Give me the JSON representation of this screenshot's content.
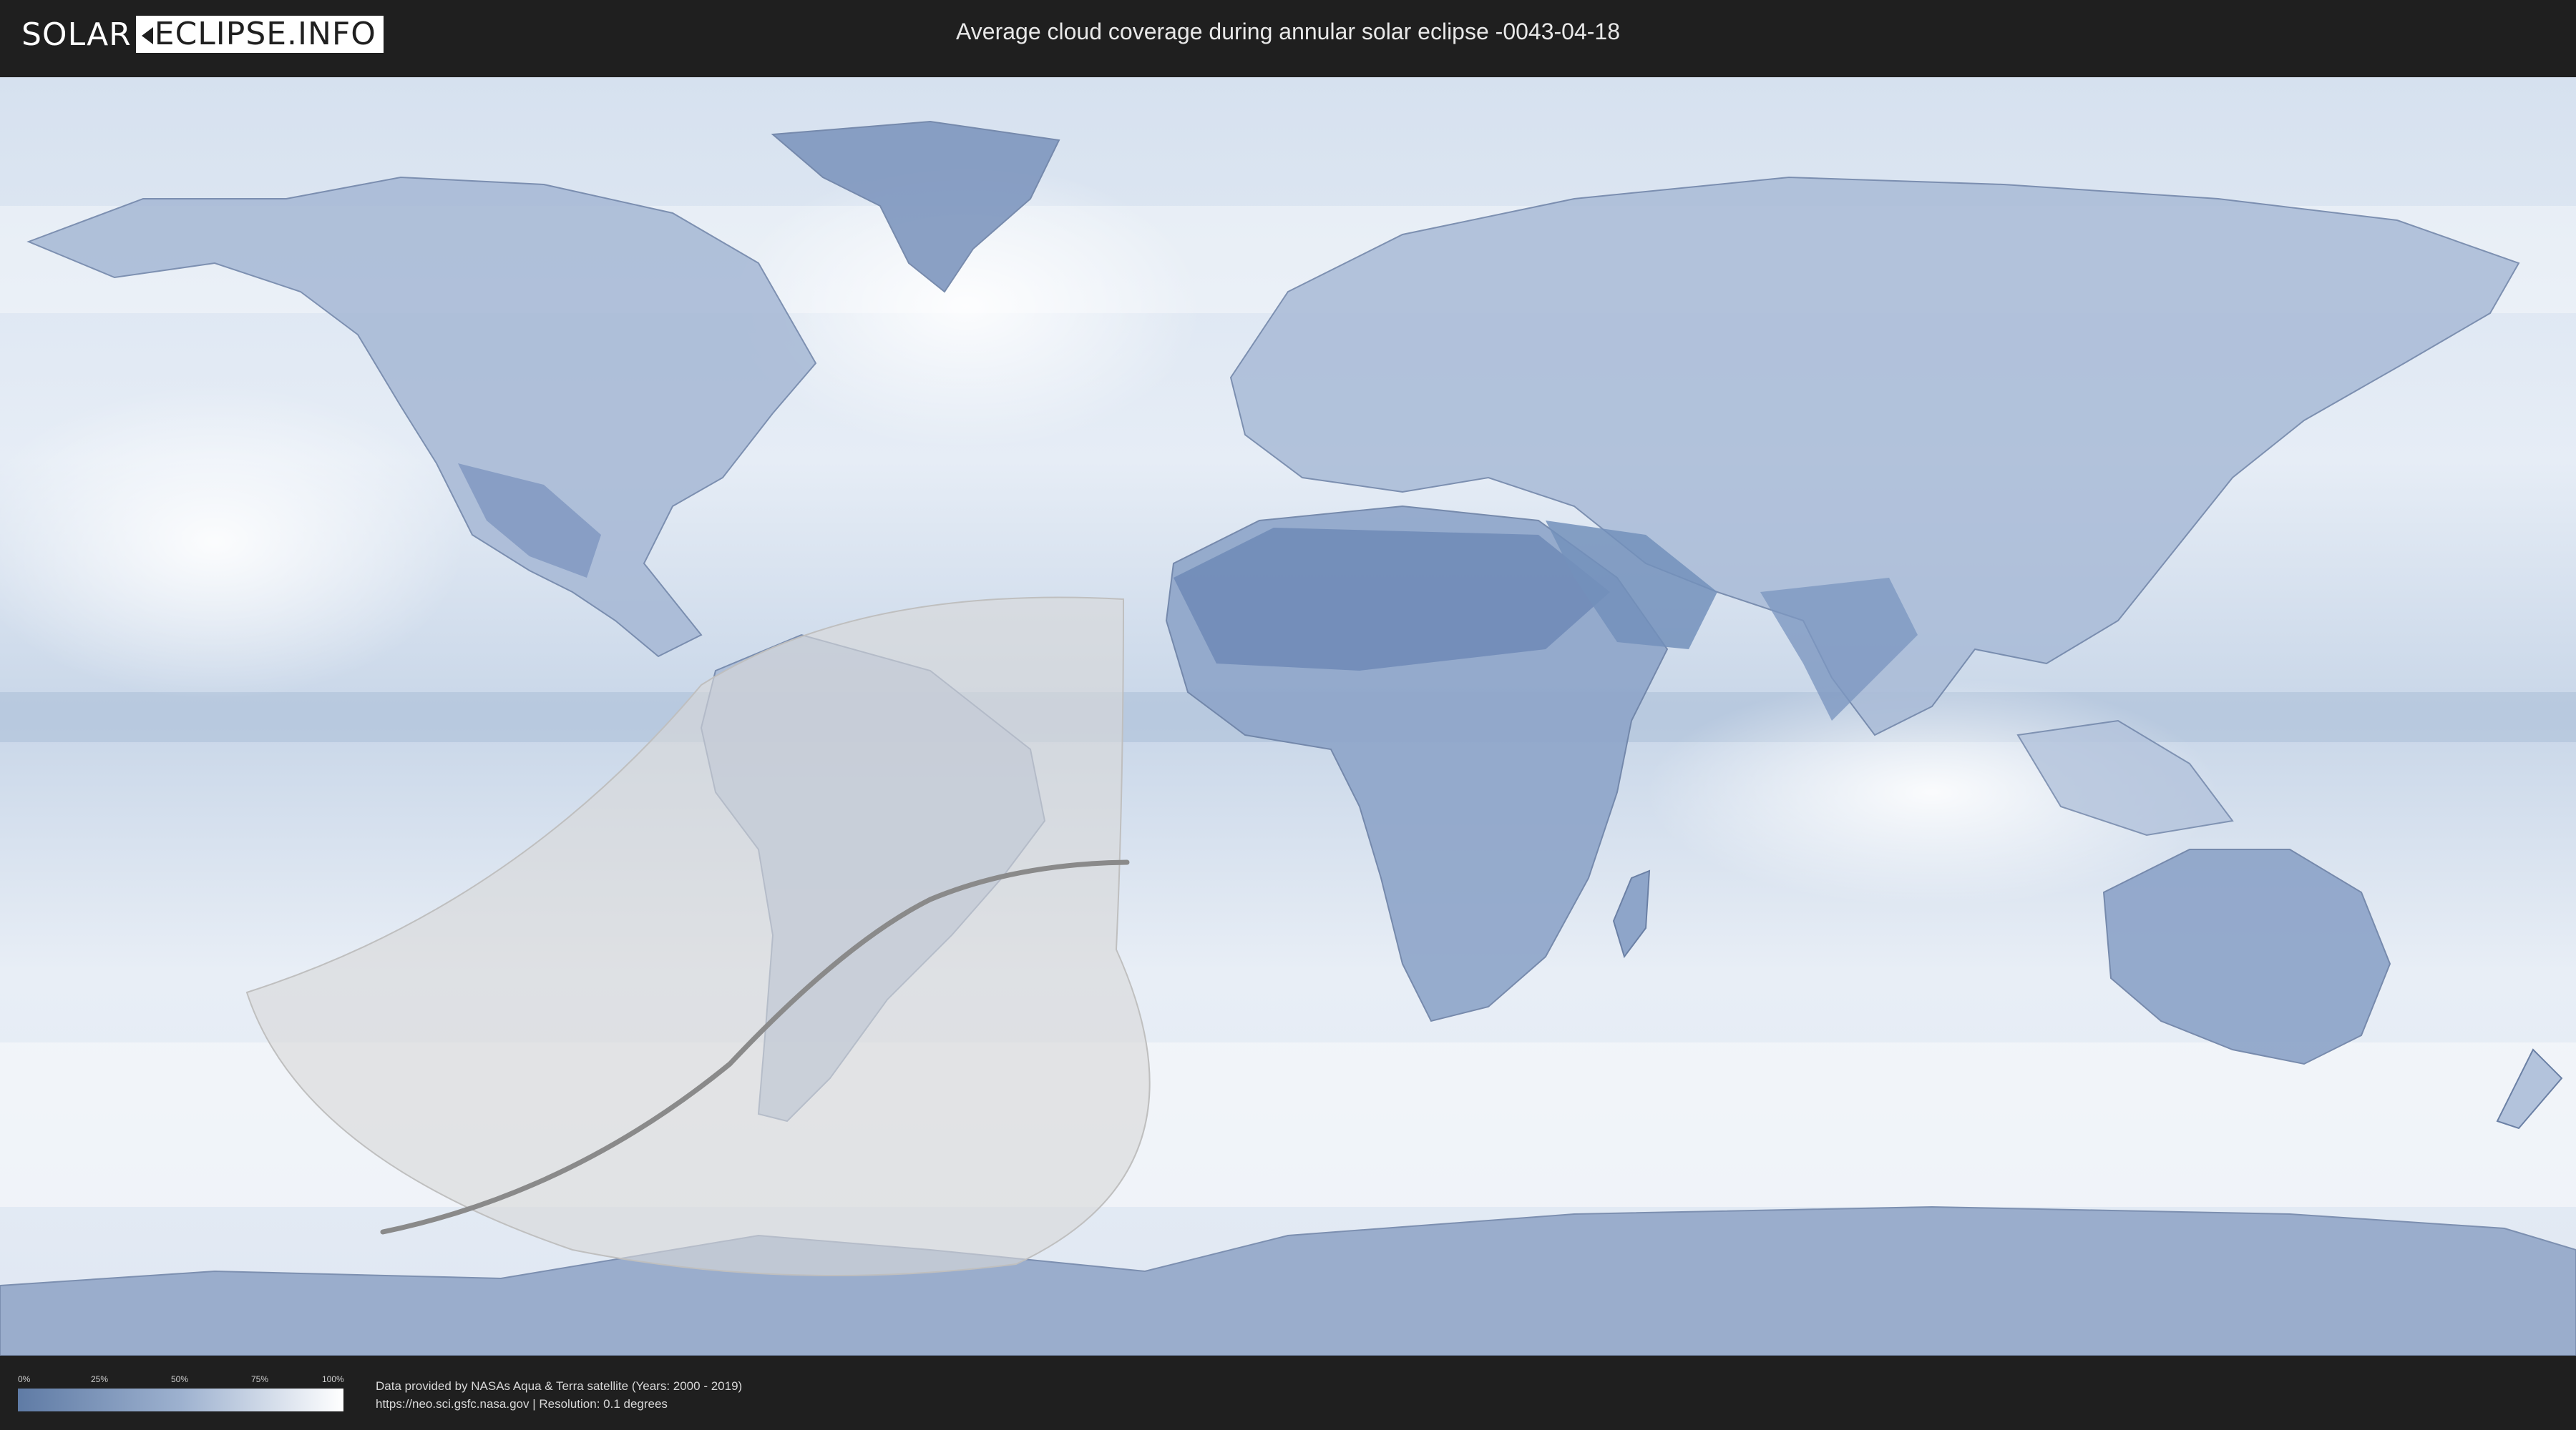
{
  "header": {
    "logo_left": "SOLAR",
    "logo_right": "ECLIPSE.INFO",
    "title": "Average cloud coverage during annular solar eclipse -0043-04-18"
  },
  "legend": {
    "ticks": [
      "0%",
      "25%",
      "50%",
      "75%",
      "100%"
    ],
    "gradient_colors": [
      "#5f7ba5",
      "#9db1cf",
      "#ffffff"
    ]
  },
  "credits": {
    "line1": "Data provided by NASAs Aqua & Terra satellite (Years: 2000 - 2019)",
    "line2": "https://neo.sci.gsfc.nasa.gov | Resolution: 0.1 degrees"
  },
  "colors": {
    "background": "#1f1f1f",
    "ocean_cloud": "#dfe8f3",
    "land_low_cloud": "#7d96bd",
    "eclipse_overlay": "#d9d9d9",
    "central_line": "#8a8a8a"
  }
}
